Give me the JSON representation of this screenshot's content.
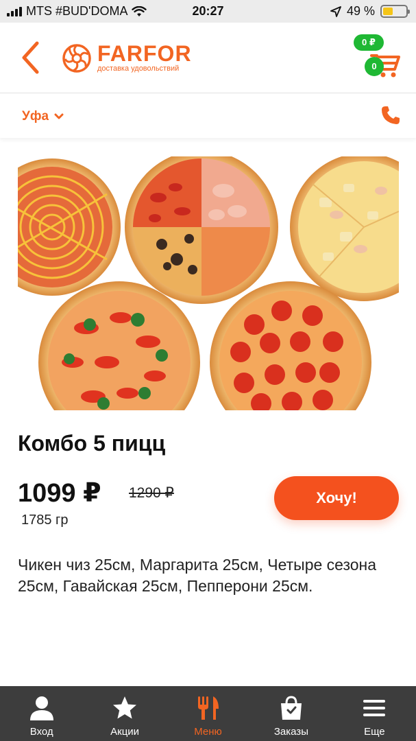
{
  "status_bar": {
    "carrier": "MTS #BUD'DOMA",
    "time": "20:27",
    "battery": "49 %"
  },
  "header": {
    "brand": "FARFOR",
    "tagline": "доставка удовольствий",
    "cart_total": "0 ₽",
    "cart_count": "0"
  },
  "city_bar": {
    "city": "Уфа"
  },
  "product": {
    "title": "Комбо 5 пицц",
    "price": "1099 ₽",
    "old_price": "1290 ₽",
    "weight": "1785 гр",
    "button_label": "Хочу!",
    "description": "Чикен чиз 25см, Маргарита 25см, Четыре сезона 25см, Гавайская 25см, Пепперони 25см."
  },
  "tab_bar": {
    "items": [
      {
        "label": "Вход",
        "icon": "user-icon"
      },
      {
        "label": "Акции",
        "icon": "star-icon"
      },
      {
        "label": "Меню",
        "icon": "fork-knife-icon"
      },
      {
        "label": "Заказы",
        "icon": "bag-icon"
      },
      {
        "label": "Еще",
        "icon": "menu-icon"
      }
    ],
    "active": "Меню"
  },
  "colors": {
    "brand_orange": "#f26522",
    "button_orange": "#f4511e",
    "cart_green": "#1fb834",
    "tabbar_bg": "#3d3d3d"
  }
}
